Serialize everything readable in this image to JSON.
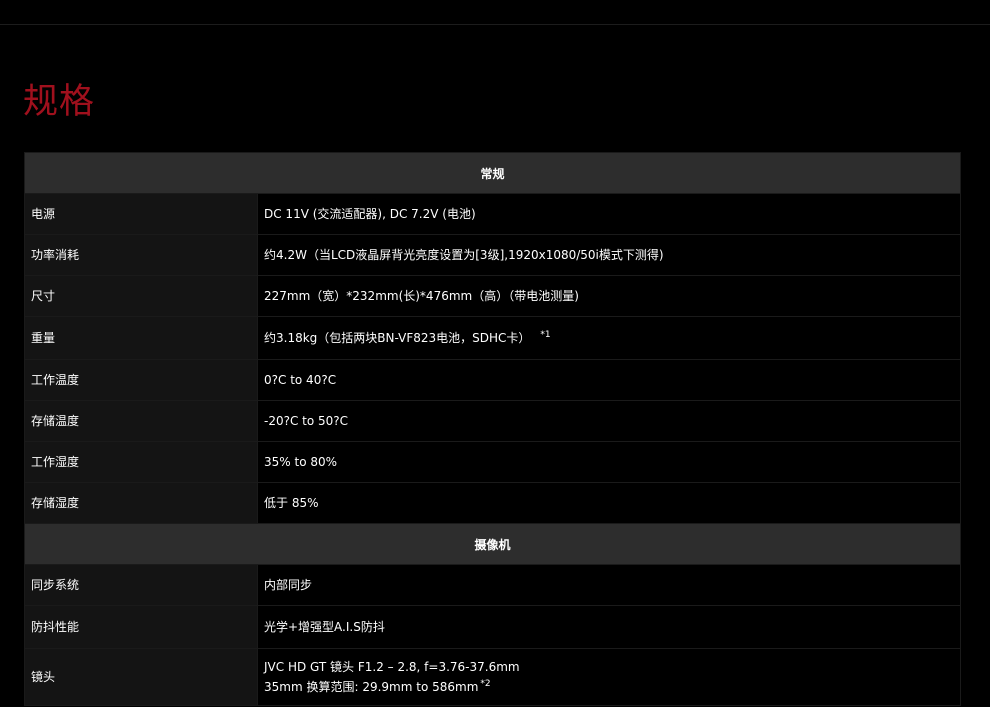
{
  "page_title": "规格",
  "sections": [
    {
      "heading": "常规",
      "rows": [
        {
          "label": "电源",
          "value": "DC 11V (交流适配器), DC 7.2V (电池)"
        },
        {
          "label": "功率消耗",
          "value": "约4.2W（当LCD液晶屏背光亮度设置为[3级],1920x1080/50i模式下测得)"
        },
        {
          "label": "尺寸",
          "value": "227mm（宽）*232mm(长)*476mm（高）（带电池测量)"
        },
        {
          "label": "重量",
          "value": "约3.18kg（包括两块BN-VF823电池，SDHC卡）",
          "note": "*1"
        },
        {
          "label": "工作温度",
          "value": "0?C to 40?C"
        },
        {
          "label": "存储温度",
          "value": "-20?C to 50?C"
        },
        {
          "label": "工作湿度",
          "value": "35% to 80%"
        },
        {
          "label": "存储湿度",
          "value": "低于 85%"
        }
      ]
    },
    {
      "heading": "摄像机",
      "rows": [
        {
          "label": "同步系统",
          "value": "内部同步"
        },
        {
          "label": "防抖性能",
          "value": "光学+增强型A.I.S防抖"
        },
        {
          "label": "镜头",
          "value_line1": "JVC HD GT 镜头 F1.2 – 2.8, f=3.76-37.6mm",
          "value_line2": "35mm 换算范围: 29.9mm to 586mm",
          "note": "*2"
        }
      ]
    }
  ]
}
